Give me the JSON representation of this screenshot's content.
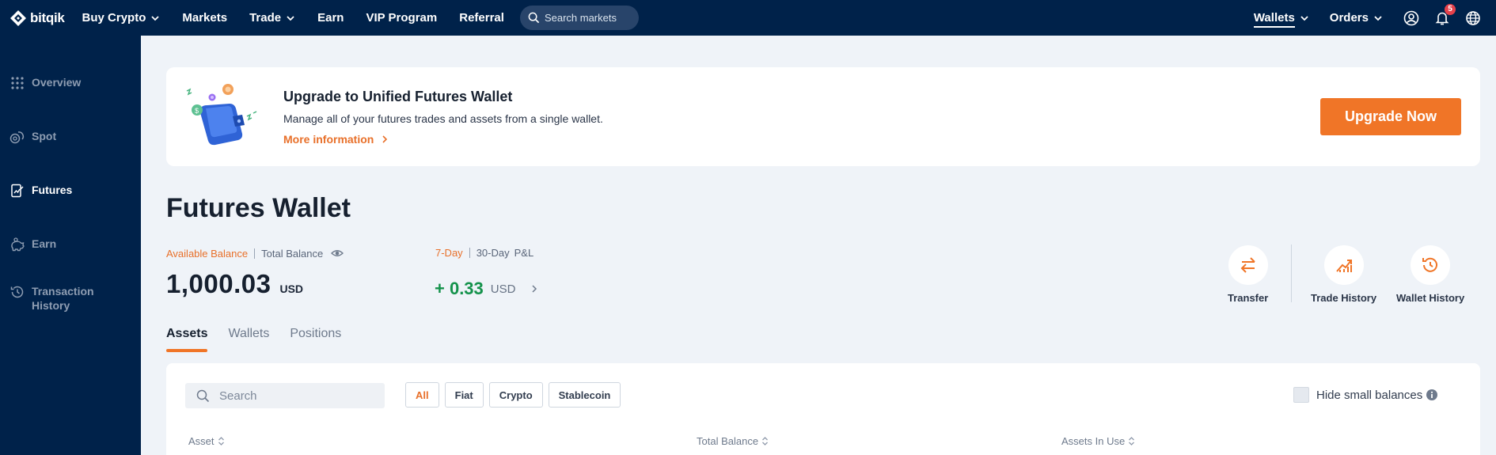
{
  "brand": {
    "name": "bitqik"
  },
  "nav": {
    "buy_crypto": "Buy Crypto",
    "markets": "Markets",
    "trade": "Trade",
    "earn": "Earn",
    "vip": "VIP Program",
    "referral": "Referral",
    "search_placeholder": "Search markets"
  },
  "right_nav": {
    "wallets": "Wallets",
    "orders": "Orders",
    "notification_count": "5"
  },
  "sidebar": {
    "items": [
      {
        "label": "Overview"
      },
      {
        "label": "Spot"
      },
      {
        "label": "Futures"
      },
      {
        "label": "Earn"
      },
      {
        "label": "Transaction History"
      }
    ]
  },
  "banner": {
    "title": "Upgrade to Unified Futures Wallet",
    "description": "Manage all of your futures trades and assets from a single wallet.",
    "link": "More information",
    "button": "Upgrade Now"
  },
  "wallet": {
    "title": "Futures Wallet",
    "available_label": "Available Balance",
    "total_label": "Total Balance",
    "balance": "1,000.03",
    "balance_unit": "USD",
    "pnl_7d_label": "7-Day",
    "pnl_30d_label": "30-Day",
    "pnl_label": "P&L",
    "pnl_value": "+ 0.33",
    "pnl_unit": "USD"
  },
  "actions": {
    "transfer": "Transfer",
    "trade_history": "Trade History",
    "wallet_history": "Wallet History"
  },
  "tabs": [
    "Assets",
    "Wallets",
    "Positions"
  ],
  "assets": {
    "search_placeholder": "Search",
    "filters": [
      "All",
      "Fiat",
      "Crypto",
      "Stablecoin"
    ],
    "hide_small": "Hide small balances",
    "columns": [
      "Asset",
      "Total Balance",
      "Assets In Use"
    ]
  },
  "colors": {
    "nav_bg": "#00224a",
    "accent": "#f07527",
    "positive": "#14924b",
    "page_bg": "#eff3f8"
  }
}
